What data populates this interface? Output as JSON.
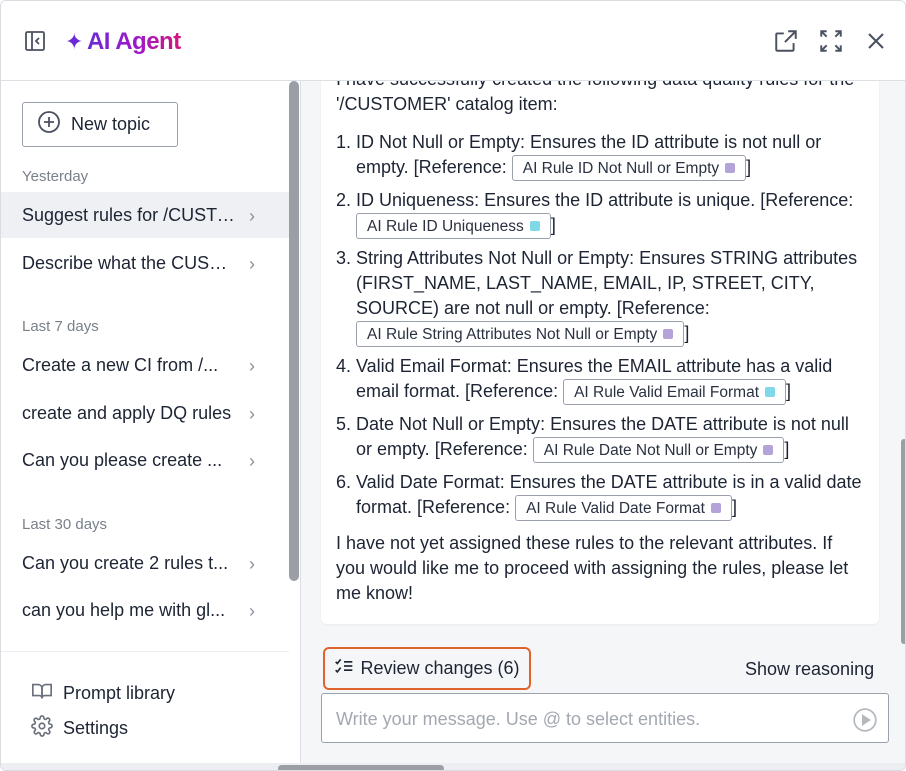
{
  "header": {
    "title": "AI Agent",
    "brand_symbol": "✦",
    "icons": {
      "sidebar_toggle": "sidebar-toggle-icon",
      "open_external": "open-external-icon",
      "expand": "expand-icon",
      "close": "close-icon"
    }
  },
  "sidebar": {
    "new_topic_label": "New topic",
    "sections": [
      {
        "label": "Yesterday",
        "items": [
          "Suggest rules for /CUSTOMER",
          "Describe what the CUSTOMER"
        ]
      },
      {
        "label": "Last 7 days",
        "items": [
          "Create a new CI from /...",
          "create and apply DQ rules",
          "Can you please create ..."
        ]
      },
      {
        "label": "Last 30 days",
        "items": [
          "Can you create 2 rules t...",
          "can you help me with gl..."
        ]
      }
    ],
    "active_item": "Suggest rules for /CUSTOMER",
    "footer": {
      "prompt_library": "Prompt library",
      "settings": "Settings"
    }
  },
  "chat": {
    "intro": "I have successfully created the following data quality rules for the '/CUSTOMER' catalog item:",
    "items": [
      {
        "num": "1.",
        "title": "ID Not Null or Empty",
        "desc": ": Ensures the ID attribute is not null or empty. [Reference: ",
        "ref": "AI Rule ID Not Null or Empty",
        "ref_color": "#b3a3d9"
      },
      {
        "num": "2.",
        "title": "ID Uniqueness",
        "desc": ": Ensures the ID attribute is unique. [Reference: ",
        "ref": "AI Rule ID Uniqueness",
        "ref_color": "#7fd8e8"
      },
      {
        "num": "3.",
        "title": "String Attributes Not Null or Empty",
        "desc": ": Ensures STRING attributes (FIRST_NAME, LAST_NAME, EMAIL, IP, STREET, CITY, SOURCE) are not null or empty. [Reference: ",
        "ref": "AI Rule String Attributes Not Null or Empty",
        "ref_color": "#b3a3d9"
      },
      {
        "num": "4.",
        "title": "Valid Email Format",
        "desc": ": Ensures the EMAIL attribute has a valid email format. [Reference: ",
        "ref": "AI Rule Valid Email Format",
        "ref_color": "#7fd8e8"
      },
      {
        "num": "5.",
        "title": "Date Not Null or Empty",
        "desc": ": Ensures the DATE attribute is not null or empty. [Reference: ",
        "ref": "AI Rule Date Not Null or Empty",
        "ref_color": "#b3a3d9"
      },
      {
        "num": "6.",
        "title": "Valid Date Format",
        "desc": ": Ensures the DATE attribute is in a valid date format. [Reference: ",
        "ref": "AI Rule Valid Date Format",
        "ref_color": "#b3a3d9"
      }
    ],
    "ref_close": "]",
    "closing": "I have not yet assigned these rules to the relevant attributes. If you would like me to proceed with assigning the rules, please let me know!"
  },
  "actions": {
    "review_changes": "Review changes (6)",
    "show_reasoning": "Show reasoning",
    "message_placeholder": "Write your message. Use @ to select entities."
  }
}
